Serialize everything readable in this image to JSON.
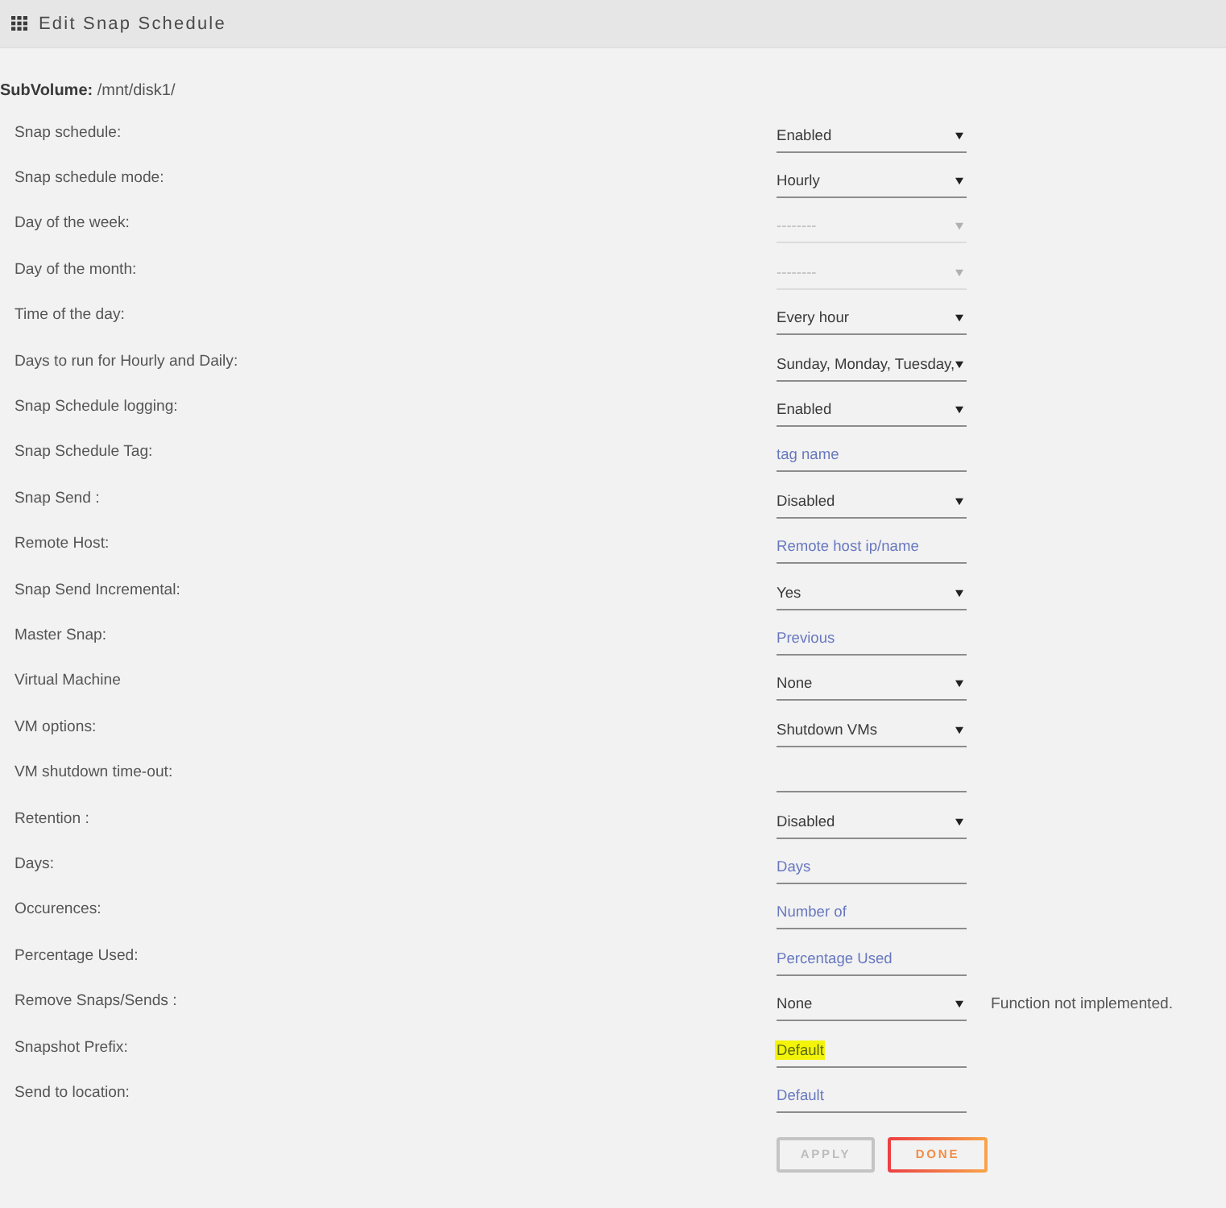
{
  "window": {
    "title": "Edit Snap Schedule"
  },
  "subvolume": "**SubVolume:** /mnt/disk1/",
  "rows": [
    {
      "label": "Snap schedule:",
      "kind": "select",
      "value": "Enabled",
      "disabled": false
    },
    {
      "label": "Snap schedule mode:",
      "kind": "select",
      "value": "Hourly",
      "disabled": false
    },
    {
      "label": "Day of the week:",
      "kind": "select",
      "value": "--------",
      "disabled": true
    },
    {
      "label": "Day of the month:",
      "kind": "select",
      "value": "--------",
      "disabled": true
    },
    {
      "label": "Time of the day:",
      "kind": "select",
      "value": "Every hour",
      "disabled": false
    },
    {
      "label": "Days to run for Hourly and Daily:",
      "kind": "select",
      "value": "Sunday, Monday, Tuesday,",
      "disabled": false
    },
    {
      "label": "Snap Schedule logging:",
      "kind": "select",
      "value": "Enabled",
      "disabled": false
    },
    {
      "label": "Snap Schedule Tag:",
      "kind": "input",
      "placeholder": "tag name",
      "highlighted": false
    },
    {
      "label": "Snap Send :",
      "kind": "select",
      "value": "Disabled",
      "disabled": false
    },
    {
      "label": "Remote Host:",
      "kind": "input",
      "placeholder": "Remote host ip/name",
      "highlighted": false
    },
    {
      "label": "Snap Send Incremental:",
      "kind": "select",
      "value": "Yes",
      "disabled": false
    },
    {
      "label": "Master Snap:",
      "kind": "input",
      "placeholder": "Previous",
      "highlighted": false
    },
    {
      "label": "Virtual Machine",
      "kind": "select",
      "value": "None",
      "disabled": false
    },
    {
      "label": "VM options:",
      "kind": "select",
      "value": "Shutdown VMs",
      "disabled": false
    },
    {
      "label": "VM shutdown time-out:",
      "kind": "input"
    },
    {
      "label": "Retention :",
      "kind": "select",
      "value": "Disabled",
      "disabled": false
    },
    {
      "label": "Days:",
      "kind": "input",
      "placeholder": "Days",
      "highlighted": false
    },
    {
      "label": "Occurences:",
      "kind": "input",
      "placeholder": "Number of",
      "highlighted": false
    },
    {
      "label": "Percentage Used:",
      "kind": "input",
      "placeholder": "Percentage Used",
      "highlighted": false
    },
    {
      "label": "Remove Snaps/Sends :",
      "kind": "select",
      "value": "None",
      "disabled": false,
      "note": "Function not implemented."
    },
    {
      "label": "Snapshot Prefix:",
      "kind": "input",
      "placeholder": "Default",
      "highlighted": true
    },
    {
      "label": "Send to location:",
      "kind": "input",
      "placeholder": "Default",
      "highlighted": false
    }
  ],
  "buttons": [
    {
      "label": "APPLY",
      "disabled": true
    },
    {
      "label": "DONE",
      "disabled": false
    }
  ]
}
